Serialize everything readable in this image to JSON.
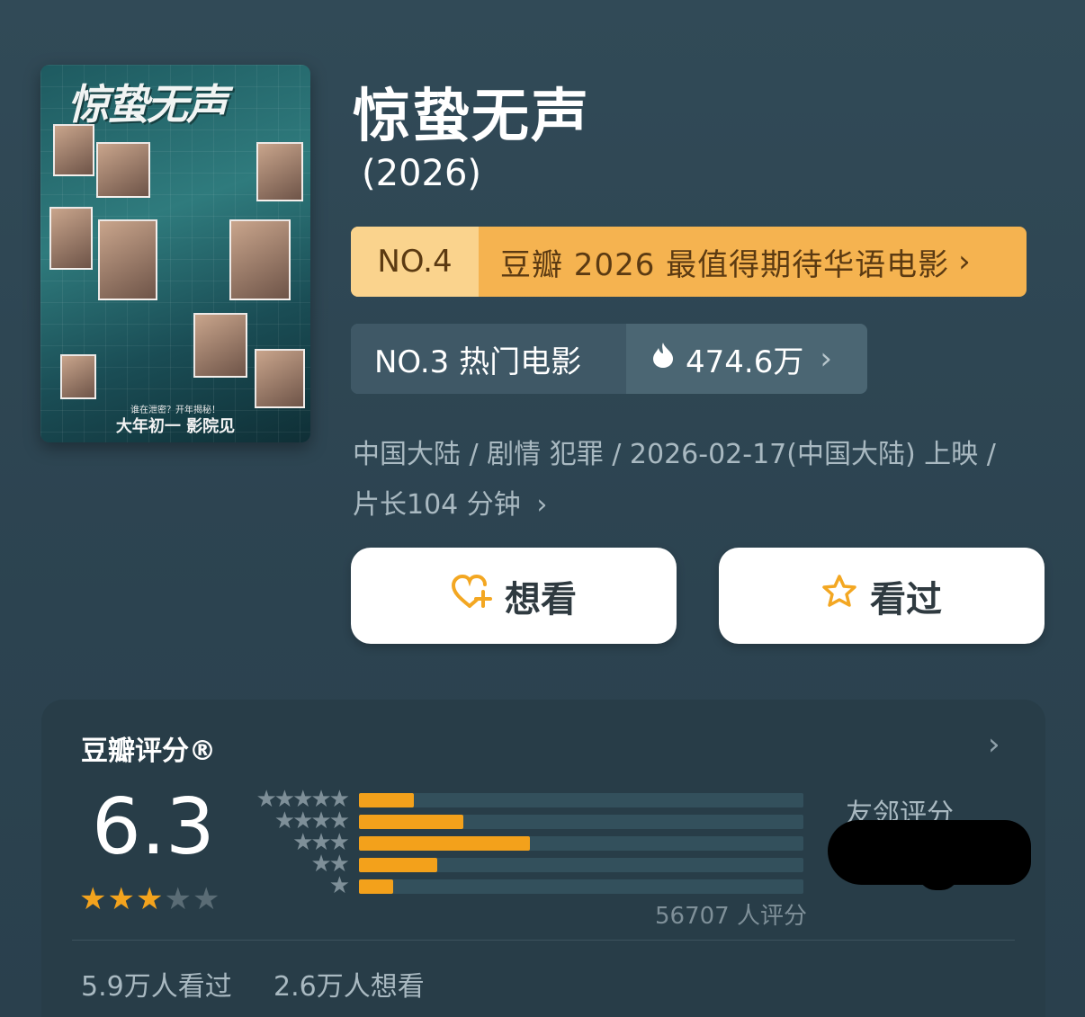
{
  "movie": {
    "title": "惊蛰无声",
    "year": "(2026)",
    "poster": {
      "title_art": "惊蛰无声",
      "tagline": "谁在泄密？开年揭秘！",
      "release_tag": "大年初一 影院见"
    }
  },
  "rank_primary": {
    "number": "NO.4",
    "list_name": "豆瓣 2026 最值得期待华语电影",
    "chevron": "›"
  },
  "rank_secondary": {
    "label": "NO.3 热门电影",
    "hot_value": "474.6万",
    "flame_icon": "flame-icon",
    "chevron": "›"
  },
  "meta": {
    "line": "中国大陆 / 剧情 犯罪 / 2026-02-17(中国大陆) 上映 /",
    "duration": "片长104 分钟",
    "chevron": "›"
  },
  "actions": {
    "want_label": "想看",
    "seen_label": "看过",
    "want_icon": "heart-plus-icon",
    "seen_icon": "star-outline-icon",
    "accent": "#f3a722"
  },
  "rating": {
    "label": "豆瓣评分®",
    "score": "6.3",
    "stars_filled": 3,
    "stars_total": 5,
    "distribution": [
      {
        "stars": "★★★★★",
        "fraction": 0.124
      },
      {
        "stars": "★★★★",
        "fraction": 0.235
      },
      {
        "stars": "★★★",
        "fraction": 0.385
      },
      {
        "stars": "★★",
        "fraction": 0.177
      },
      {
        "stars": "★",
        "fraction": 0.077
      }
    ],
    "count_text": "56707 人评分",
    "friend_label": "友邻评分",
    "chevron": "›",
    "accent": "#f3a11b"
  },
  "footer": {
    "seen_count": "5.9万人看过",
    "want_count": "2.6万人想看"
  }
}
